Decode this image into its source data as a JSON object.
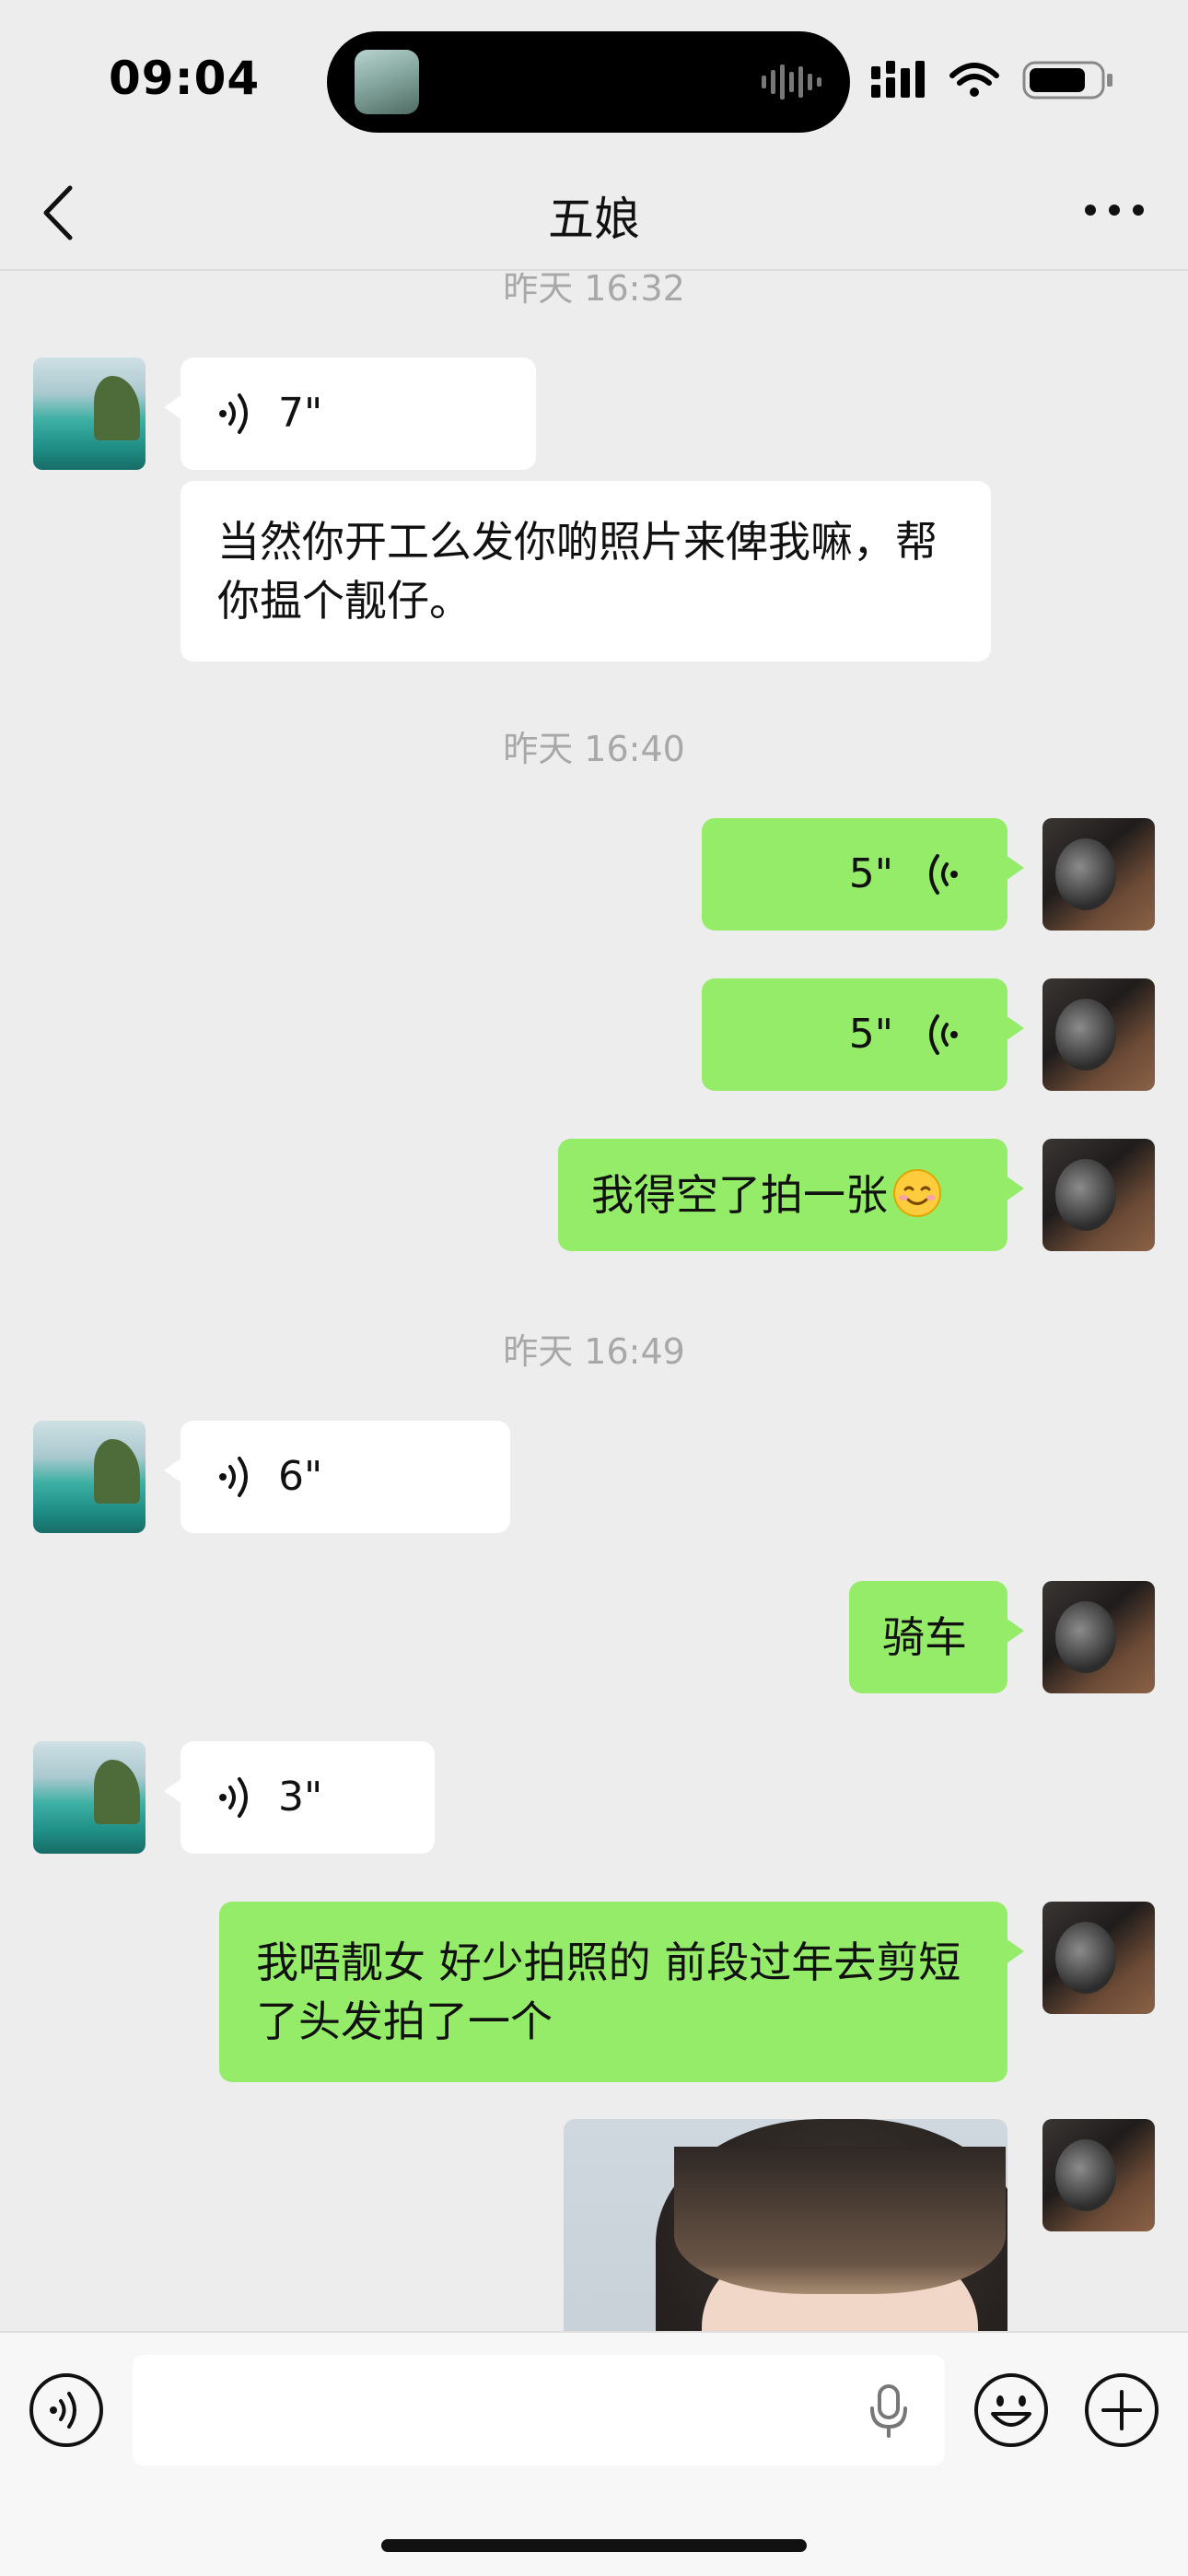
{
  "status_bar": {
    "time": "09:04"
  },
  "nav": {
    "title": "五娘"
  },
  "messages": [
    {
      "type": "timestamp",
      "text": "昨天 16:32"
    },
    {
      "type": "voice",
      "from": "other",
      "duration": "7\""
    },
    {
      "type": "text",
      "from": "other",
      "text": "当然你开工么发你啲照片来俾我嘛，帮你揾个靓仔。"
    },
    {
      "type": "timestamp",
      "text": "昨天 16:40"
    },
    {
      "type": "voice",
      "from": "me",
      "duration": "5\""
    },
    {
      "type": "voice",
      "from": "me",
      "duration": "5\""
    },
    {
      "type": "text",
      "from": "me",
      "text": "我得空了拍一张",
      "emoji": "smiling-face-icon"
    },
    {
      "type": "timestamp",
      "text": "昨天 16:49"
    },
    {
      "type": "voice",
      "from": "other",
      "duration": "6\""
    },
    {
      "type": "text",
      "from": "me",
      "text": "骑车"
    },
    {
      "type": "voice",
      "from": "other",
      "duration": "3\""
    },
    {
      "type": "text",
      "from": "me",
      "text": "我唔靓女 好少拍照的 前段过年去剪短了头发拍了一个"
    },
    {
      "type": "image",
      "from": "me"
    }
  ],
  "colors": {
    "background": "#ededed",
    "my_bubble": "#95ec69",
    "other_bubble": "#ffffff",
    "timestamp": "#a8a8a8"
  },
  "input_bar": {
    "value": "",
    "icons": [
      "voice-mode-icon",
      "mic-icon",
      "emoji-icon",
      "plus-icon"
    ]
  }
}
